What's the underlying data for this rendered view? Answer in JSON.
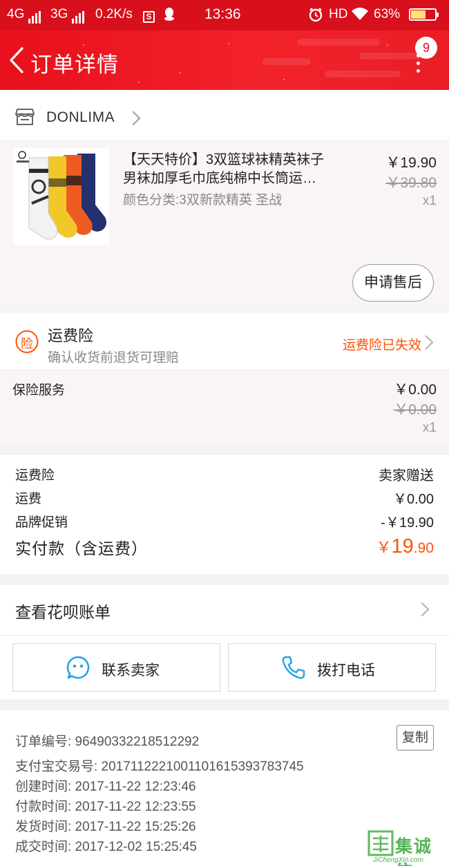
{
  "status_bar": {
    "network1": "4G",
    "network2": "3G",
    "speed": "0.2K/s",
    "time": "13:36",
    "hd": "HD",
    "battery": "63%"
  },
  "header": {
    "title": "订单详情",
    "badge_count": "9"
  },
  "store": {
    "name": "DONLIMA"
  },
  "product": {
    "title_line1": "【天天特价】3双篮球袜精英袜子",
    "title_line2": "男袜加厚毛巾底纯棉中长筒运…",
    "sku": "颜色分类:3双新款精英 圣战",
    "price": "￥19.90",
    "original_price": "￥39.80",
    "quantity": "x1",
    "after_sale_label": "申请售后"
  },
  "insurance": {
    "icon_char": "险",
    "title": "运费险",
    "subtitle": "确认收货前退货可理赔",
    "status": "运费险已失效"
  },
  "service": {
    "label": "保险服务",
    "price": "￥0.00",
    "original_price": "￥0.00",
    "quantity": "x1"
  },
  "summary": {
    "rows": [
      {
        "label": "运费险",
        "value": "卖家赠送"
      },
      {
        "label": "运费",
        "value": "￥0.00"
      },
      {
        "label": "品牌促销",
        "value": "-￥19.90"
      }
    ],
    "total_label": "实付款（含运费）",
    "total_currency": "￥",
    "total_int": "19",
    "total_dec": ".90"
  },
  "huabei": {
    "label": "查看花呗账单"
  },
  "actions": {
    "contact_seller": "联系卖家",
    "call_phone": "拨打电话"
  },
  "order_info": {
    "order_no": "订单编号: 96490332218512292",
    "alipay_no": "支付宝交易号: 2017112221001101615393783745",
    "created": "创建时间: 2017-11-22 12:23:46",
    "paid": "付款时间: 2017-11-22 12:23:55",
    "shipped": "发货时间: 2017-11-22 15:25:26",
    "completed": "成交时间: 2017-12-02 15:25:45",
    "copy_label": "复制"
  },
  "watermark": {
    "text": "集诚信",
    "url": "JiChengXin.com"
  },
  "colors": {
    "header_red": "#e8101c",
    "accent_orange": "#ff5000",
    "icon_blue": "#1fa3e6"
  }
}
